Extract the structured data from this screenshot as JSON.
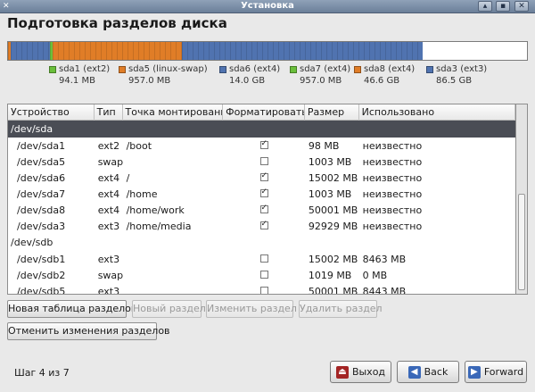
{
  "window": {
    "title": "Установка"
  },
  "page": {
    "title": "Подготовка разделов диска"
  },
  "disk_bar": {
    "segments": [
      {
        "name": "sda1",
        "color": "#6abf3b",
        "fraction": 0.0005
      },
      {
        "name": "sda5",
        "color": "#e07d27",
        "fraction": 0.0049
      },
      {
        "name": "sda6",
        "color": "#5073b0",
        "fraction": 0.0749
      },
      {
        "name": "sda7",
        "color": "#6abf3b",
        "fraction": 0.0049
      },
      {
        "name": "sda8",
        "color": "#e07d27",
        "fraction": 0.2496
      },
      {
        "name": "sda3",
        "color": "#5073b0",
        "fraction": 0.464
      }
    ],
    "legend": [
      {
        "name": "sda1 (ext2)",
        "size": "94.1 MB",
        "color": "#6abf3b"
      },
      {
        "name": "sda5 (linux-swap)",
        "size": "957.0 MB",
        "color": "#e07d27"
      },
      {
        "name": "sda6 (ext4)",
        "size": "14.0 GB",
        "color": "#5073b0"
      },
      {
        "name": "sda7 (ext4)",
        "size": "957.0 MB",
        "color": "#6abf3b"
      },
      {
        "name": "sda8 (ext4)",
        "size": "46.6 GB",
        "color": "#e07d27"
      },
      {
        "name": "sda3 (ext3)",
        "size": "86.5 GB",
        "color": "#5073b0"
      }
    ]
  },
  "table": {
    "columns": [
      "Устройство",
      "Тип",
      "Точка монтирования",
      "Форматировать?",
      "Размер",
      "Использовано"
    ],
    "groups": [
      {
        "name": "/dev/sda",
        "selected": true,
        "rows": [
          {
            "device": "/dev/sda1",
            "type": "ext2",
            "mount": "/boot",
            "format": true,
            "size": "98 MB",
            "used": "неизвестно"
          },
          {
            "device": "/dev/sda5",
            "type": "swap",
            "mount": "",
            "format": false,
            "size": "1003 MB",
            "used": "неизвестно"
          },
          {
            "device": "/dev/sda6",
            "type": "ext4",
            "mount": "/",
            "format": true,
            "size": "15002 MB",
            "used": "неизвестно"
          },
          {
            "device": "/dev/sda7",
            "type": "ext4",
            "mount": "/home",
            "format": true,
            "size": "1003 MB",
            "used": "неизвестно"
          },
          {
            "device": "/dev/sda8",
            "type": "ext4",
            "mount": "/home/work",
            "format": true,
            "size": "50001 MB",
            "used": "неизвестно"
          },
          {
            "device": "/dev/sda3",
            "type": "ext3",
            "mount": "/home/media",
            "format": true,
            "size": "92929 MB",
            "used": "неизвестно"
          }
        ]
      },
      {
        "name": "/dev/sdb",
        "selected": false,
        "rows": [
          {
            "device": "/dev/sdb1",
            "type": "ext3",
            "mount": "",
            "format": false,
            "size": "15002 MB",
            "used": "8463 MB"
          },
          {
            "device": "/dev/sdb2",
            "type": "swap",
            "mount": "",
            "format": false,
            "size": "1019 MB",
            "used": "0 MB"
          },
          {
            "device": "/dev/sdb5",
            "type": "ext3",
            "mount": "",
            "format": false,
            "size": "50001 MB",
            "used": "8443 MB"
          }
        ]
      }
    ]
  },
  "actions": {
    "new_table": "Новая таблица разделов",
    "new_partition": "Новый раздел",
    "edit_partition": "Изменить раздел",
    "delete_partition": "Удалить раздел",
    "revert": "Отменить изменения разделов"
  },
  "footer": {
    "step": "Шаг 4 из 7",
    "quit": "Выход",
    "back": "Back",
    "forward": "Forward"
  }
}
